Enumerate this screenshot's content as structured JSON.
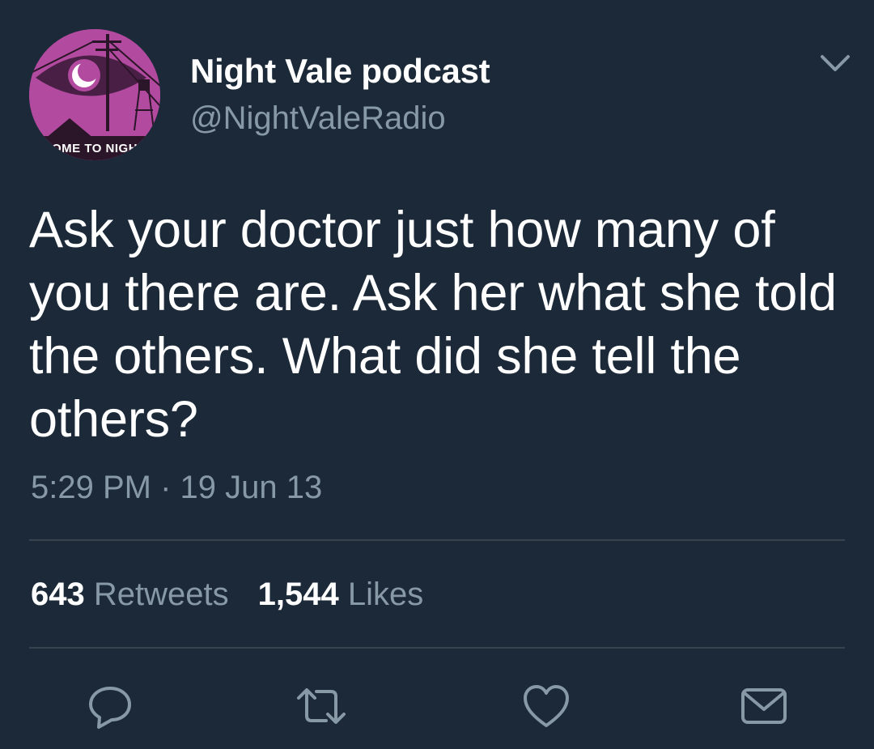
{
  "author": {
    "display_name": "Night Vale podcast",
    "handle": "@NightValeRadio",
    "avatar_icon": "night-vale-logo-icon",
    "avatar_text": "COME TO NIGHT VALE"
  },
  "tweet": {
    "text": "Ask your doctor just how many of you there are. Ask her what she told the others. What did she tell the others?",
    "timestamp": "5:29 PM · 19 Jun 13"
  },
  "stats": {
    "retweets_count": "643",
    "retweets_label": "Retweets",
    "likes_count": "1,544",
    "likes_label": "Likes"
  },
  "actions": {
    "reply_icon": "reply-icon",
    "retweet_icon": "retweet-icon",
    "like_icon": "heart-icon",
    "dm_icon": "envelope-icon",
    "menu_icon": "chevron-down-icon"
  },
  "colors": {
    "background": "#1c2938",
    "text_primary": "#ffffff",
    "text_secondary": "#8899a6",
    "divider": "#38444d",
    "avatar_purple": "#b24a9f"
  }
}
